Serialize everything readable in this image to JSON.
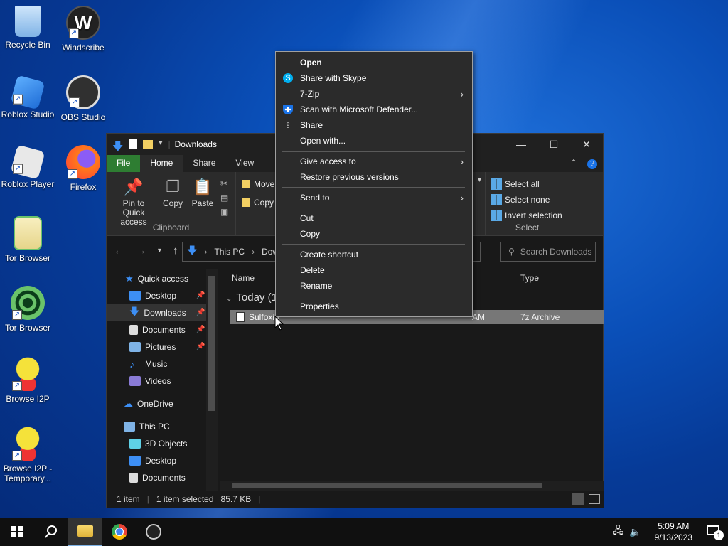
{
  "desktop": {
    "icons": [
      {
        "label": "Recycle Bin",
        "icon": "recycle-bin-icon",
        "color": "#9fc7ee"
      },
      {
        "label": "Windscribe",
        "icon": "windscribe-icon",
        "color": "#222222"
      },
      {
        "label": "Roblox Studio",
        "icon": "roblox-studio-icon",
        "color": "#3a8ee6"
      },
      {
        "label": "OBS Studio",
        "icon": "obs-studio-icon",
        "color": "#303030"
      },
      {
        "label": "Roblox Player",
        "icon": "roblox-player-icon",
        "color": "#e8e8e8"
      },
      {
        "label": "Firefox",
        "icon": "firefox-icon",
        "color": "#ff7a1a"
      },
      {
        "label": "Tor Browser",
        "icon": "tor-browser-folder-icon",
        "color": "#f3e6a0"
      },
      {
        "label": "Tor Browser",
        "icon": "tor-browser-icon",
        "color": "#6ac36a"
      },
      {
        "label": "Browse I2P",
        "icon": "browse-i2p-icon",
        "color": "#f5e23a"
      },
      {
        "label": "Browse I2P - Temporary...",
        "icon": "browse-i2p-temp-icon",
        "color": "#f5e23a"
      }
    ]
  },
  "explorer": {
    "title": "Downloads",
    "tabs": {
      "file": "File",
      "home": "Home",
      "share": "Share",
      "view": "View"
    },
    "ribbon": {
      "pin": "Pin to Quick access",
      "copy": "Copy",
      "paste": "Paste",
      "clipboard": "Clipboard",
      "move": "Move",
      "copy_to": "Copy",
      "select_all": "Select all",
      "select_none": "Select none",
      "invert": "Invert selection",
      "select": "Select"
    },
    "address": {
      "this_pc": "This PC",
      "down": "Down"
    },
    "search_placeholder": "Search Downloads",
    "nav": {
      "quick_access": "Quick access",
      "desktop": "Desktop",
      "downloads": "Downloads",
      "documents": "Documents",
      "pictures": "Pictures",
      "music": "Music",
      "videos": "Videos",
      "onedrive": "OneDrive",
      "this_pc": "This PC",
      "objects3d": "3D Objects",
      "desktop2": "Desktop",
      "documents2": "Documents"
    },
    "columns": {
      "name": "Name",
      "type": "Type"
    },
    "group": "Today (1",
    "file": {
      "name": "Sulfoxid",
      "date_fragment": "AM",
      "type": "7z Archive"
    },
    "status": {
      "items": "1 item",
      "selected": "1 item selected",
      "size": "85.7 KB"
    }
  },
  "context_menu": {
    "open": "Open",
    "skype": "Share with Skype",
    "zip": "7-Zip",
    "defender": "Scan with Microsoft Defender...",
    "share": "Share",
    "open_with": "Open with...",
    "give_access": "Give access to",
    "restore": "Restore previous versions",
    "send_to": "Send to",
    "cut": "Cut",
    "copy": "Copy",
    "create_shortcut": "Create shortcut",
    "delete": "Delete",
    "rename": "Rename",
    "properties": "Properties"
  },
  "taskbar": {
    "time": "5:09 AM",
    "date": "9/13/2023",
    "notifications": "1"
  }
}
